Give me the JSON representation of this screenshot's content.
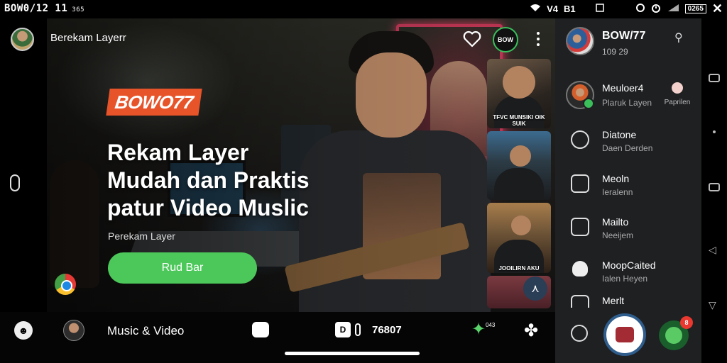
{
  "status_bar": {
    "left_text": "BOW0/12 11",
    "left_small": "365",
    "signal_label": "V4",
    "carrier": "B1",
    "battery": "0265"
  },
  "hero": {
    "top_title": "Berekam Layerr",
    "brand": "BOWO77",
    "title_lines": [
      "Rekam Layer",
      "Mudah dan Praktis",
      "patur Video Muslic"
    ],
    "subtitle": "Perekam Layer",
    "cta_label": "Rud Bar",
    "logo_button_label": "BOW"
  },
  "thumbnails": [
    {
      "caption": "TFVC MUNSIKI OIK SUIK"
    },
    {
      "caption": ""
    },
    {
      "caption": "JOOILIRN AKU"
    },
    {
      "caption": ""
    }
  ],
  "bottom_bar": {
    "section_label": "Music & Video",
    "media_label": "D",
    "count": "76807",
    "star_num": "043"
  },
  "panel": {
    "header": {
      "title": "BOW/77",
      "subtitle": "109  29"
    },
    "items": [
      {
        "title": "Meuloer4",
        "subtitle": "Plaruk Layen",
        "action_label": "Paprilen"
      },
      {
        "title": "Diatone",
        "subtitle": "Daen Derden"
      },
      {
        "title": "Meoln",
        "subtitle": "Ieralenn"
      },
      {
        "title": "Mailto",
        "subtitle": "Neeijem"
      },
      {
        "title": "MoopCaited",
        "subtitle": "Ialen Heyen"
      },
      {
        "title": "Merlt",
        "subtitle": ""
      }
    ],
    "badge_count": "8"
  },
  "colors": {
    "accent_green": "#4cc85a",
    "brand_orange": "#e8542a",
    "panel_bg": "#1e2022",
    "badge_red": "#e8382f"
  }
}
